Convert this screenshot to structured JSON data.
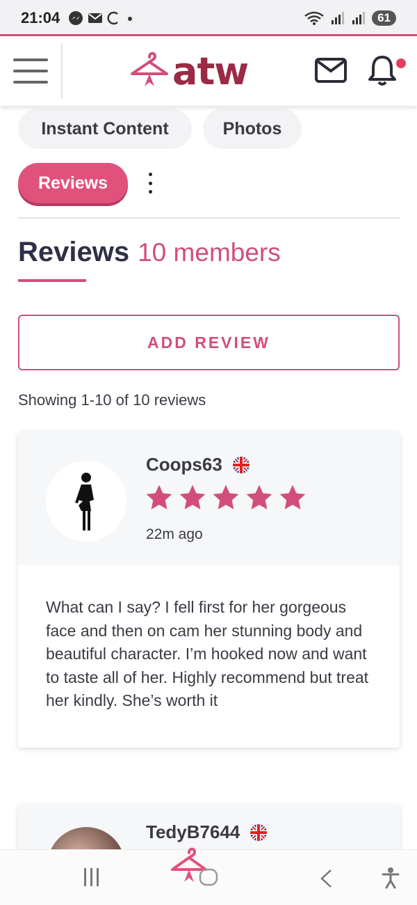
{
  "status_bar": {
    "time": "21:04",
    "battery": "61"
  },
  "header": {
    "logo_text": "atw"
  },
  "tabs": [
    {
      "label": "Instant Content"
    },
    {
      "label": "Photos"
    },
    {
      "label": "Reviews",
      "active": true
    }
  ],
  "section": {
    "title": "Reviews",
    "member_count": "10 members",
    "add_review_label": "ADD REVIEW",
    "showing_text": "Showing 1-10 of 10 reviews"
  },
  "reviews": [
    {
      "username": "Coops63",
      "country_flag": "uk-flag-icon",
      "rating": 5,
      "max_rating": 5,
      "time_ago": "22m ago",
      "text": "What can I say? I fell first for her gorgeous face and then on cam her stunning body and beautiful character. I’m hooked now and want to taste all of her. Highly recommend but treat her kindly. She’s worth it"
    },
    {
      "username": "TedyB7644",
      "country_flag": "uk-flag-icon"
    }
  ],
  "colors": {
    "accent": "#d24e78",
    "brand_dark": "#9a2a46",
    "text": "#3a3a44"
  }
}
